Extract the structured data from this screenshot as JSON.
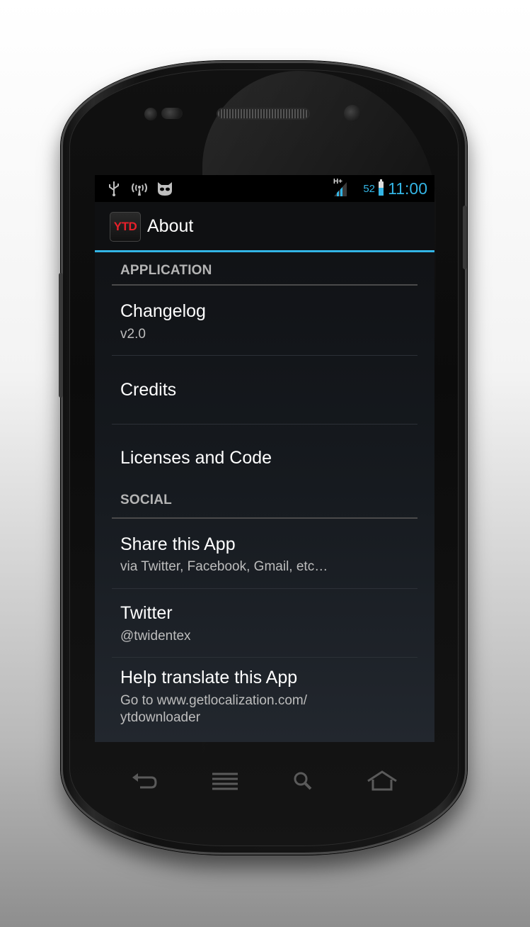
{
  "statusbar": {
    "clock": "11:00",
    "battery_percent": "52",
    "network_type": "H+",
    "icons": [
      "usb-icon",
      "hotspot-icon",
      "cyanogen-icon"
    ]
  },
  "actionbar": {
    "logo_text": "YTD",
    "title": "About"
  },
  "sections": [
    {
      "header": "APPLICATION"
    },
    {
      "header": "SOCIAL"
    }
  ],
  "application_items": [
    {
      "title": "Changelog",
      "summary": "v2.0"
    },
    {
      "title": "Credits"
    },
    {
      "title": "Licenses and Code"
    }
  ],
  "social_items": [
    {
      "title": "Share this App",
      "summary": "via Twitter, Facebook, Gmail, etc…"
    },
    {
      "title": "Twitter",
      "summary": "@twidentex"
    },
    {
      "title": "Help translate this App",
      "summary_line1": "Go to www.getlocalization.com/",
      "summary_line2": "ytdownloader"
    }
  ],
  "navbar": [
    "back-icon",
    "recent-apps-icon",
    "search-icon",
    "home-icon"
  ],
  "colors": {
    "accent": "#33b5e5",
    "logo_red": "#e8202a"
  }
}
